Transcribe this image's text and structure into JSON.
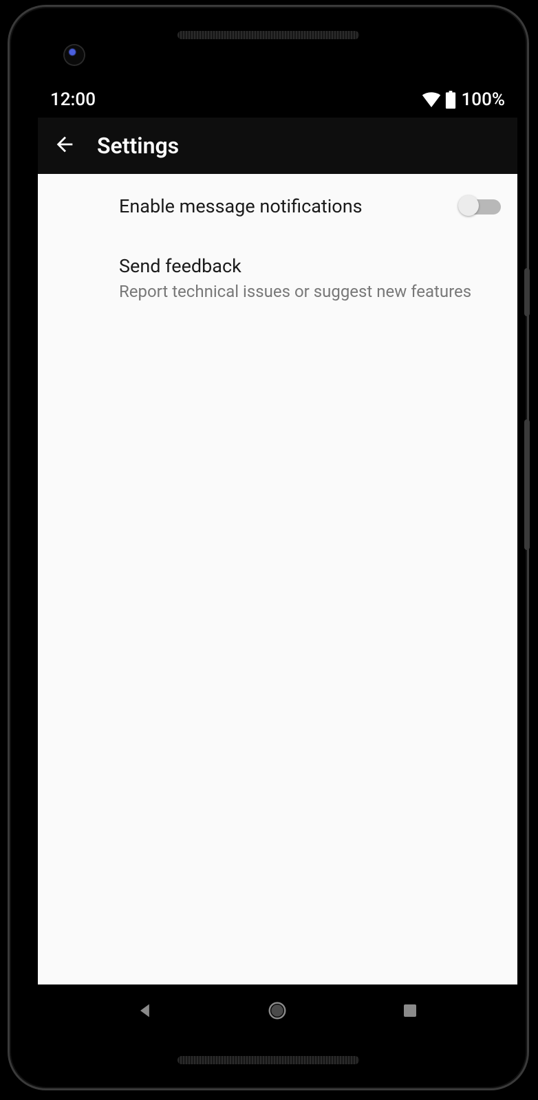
{
  "status": {
    "time": "12:00",
    "battery_pct": "100%"
  },
  "appbar": {
    "title": "Settings"
  },
  "settings": {
    "items": [
      {
        "title": "Enable message notifications",
        "subtitle": "",
        "toggle": false
      },
      {
        "title": "Send feedback",
        "subtitle": "Report technical issues or suggest new features"
      }
    ]
  }
}
